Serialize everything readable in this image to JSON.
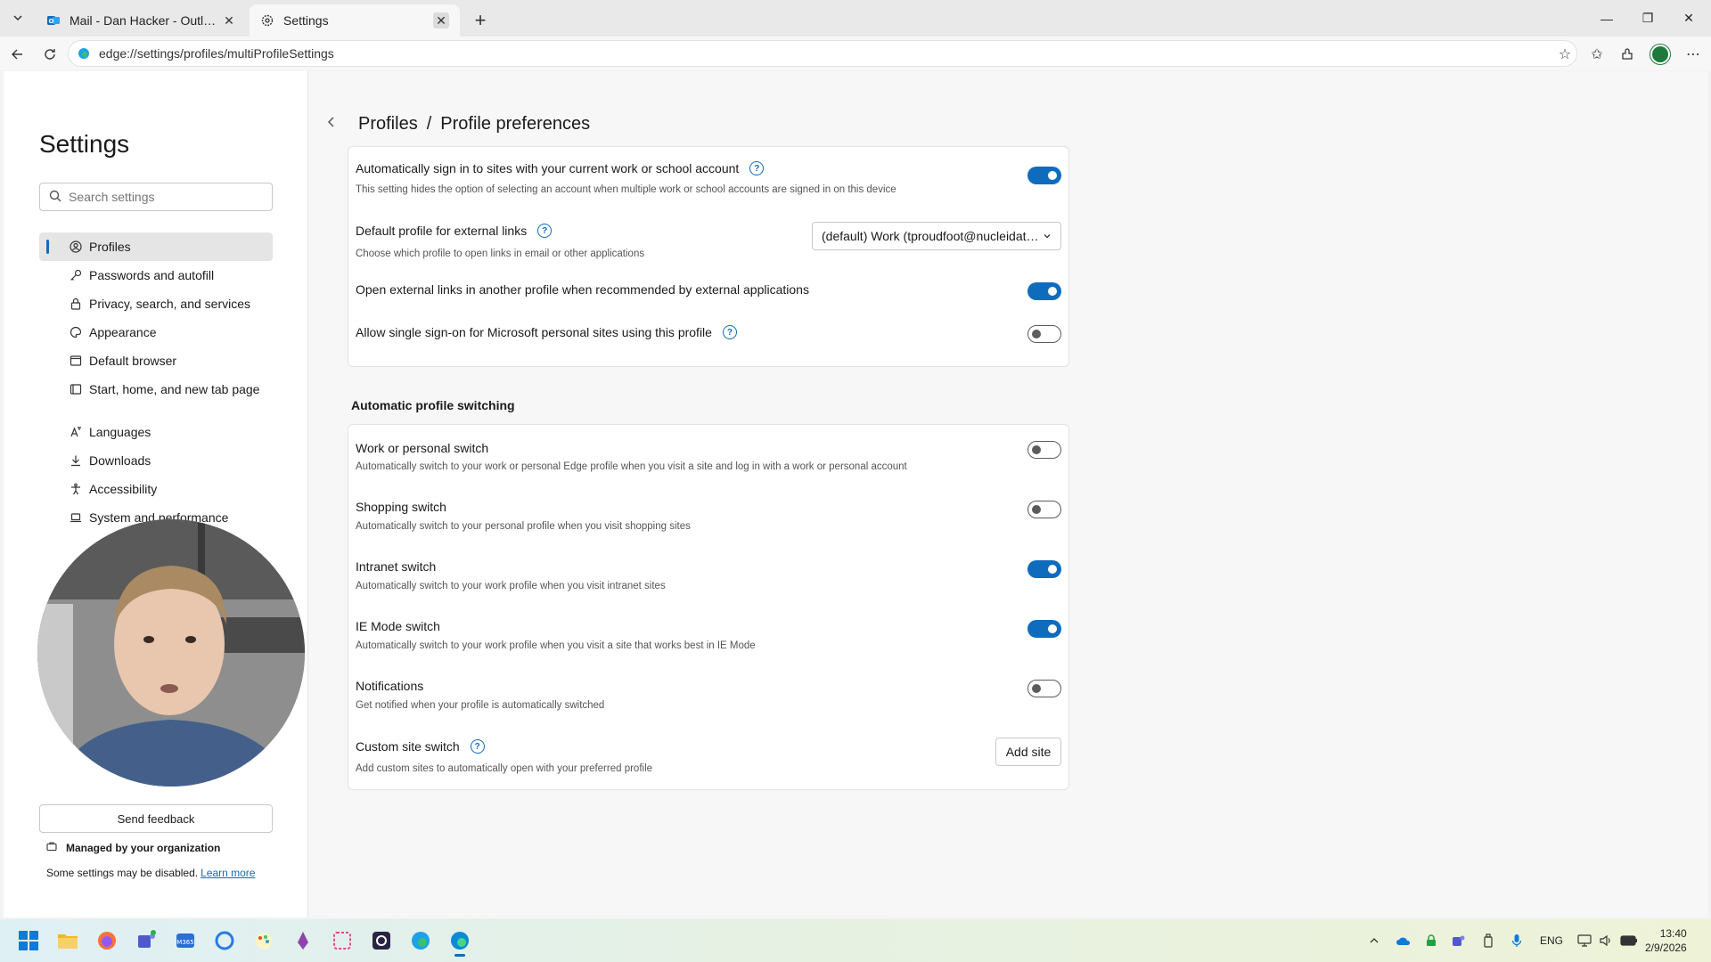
{
  "tabs": [
    {
      "title": "Mail - Dan Hacker - Outlook",
      "icon": "outlook-icon"
    },
    {
      "title": "Settings",
      "icon": "gear-icon"
    }
  ],
  "address": {
    "url": "edge://settings/profiles/multiProfileSettings"
  },
  "sidebar": {
    "title": "Settings",
    "search_placeholder": "Search settings",
    "items": [
      {
        "label": "Profiles",
        "icon": "profile-icon"
      },
      {
        "label": "Passwords and autofill",
        "icon": "key-icon"
      },
      {
        "label": "Privacy, search, and services",
        "icon": "lock-icon"
      },
      {
        "label": "Appearance",
        "icon": "palette-icon"
      },
      {
        "label": "Default browser",
        "icon": "browser-icon"
      },
      {
        "label": "Start, home, and new tab page",
        "icon": "home-icon"
      },
      {
        "label": "Languages",
        "icon": "languages-icon"
      },
      {
        "label": "Downloads",
        "icon": "download-icon"
      },
      {
        "label": "Accessibility",
        "icon": "accessibility-icon"
      },
      {
        "label": "System and performance",
        "icon": "laptop-icon"
      }
    ],
    "feedback_label": "Send feedback",
    "managed_label": "Managed by your organization",
    "managed_note": "Some settings may be disabled.",
    "learn_more": "Learn more"
  },
  "breadcrumb": {
    "parent": "Profiles",
    "separator": "/",
    "current": "Profile preferences"
  },
  "preferences": {
    "auto_signin": {
      "title": "Automatically sign in to sites with your current work or school account",
      "desc": "This setting hides the option of selecting an account when multiple work or school accounts are signed in on this device",
      "on": true
    },
    "default_profile": {
      "title": "Default profile for external links",
      "desc": "Choose which profile to open links in email or other applications",
      "value": "(default) Work (tproudfoot@nucleidatacenter.com)"
    },
    "open_external": {
      "title": "Open external links in another profile when recommended by external applications",
      "on": true
    },
    "sso_personal": {
      "title": "Allow single sign-on for Microsoft personal sites using this profile",
      "on": false
    }
  },
  "switching": {
    "section_title": "Automatic profile switching",
    "work_personal": {
      "title": "Work or personal switch",
      "desc": "Automatically switch to your work or personal Edge profile when you visit a site and log in with a work or personal account",
      "on": false
    },
    "shopping": {
      "title": "Shopping switch",
      "desc": "Automatically switch to your personal profile when you visit shopping sites",
      "on": false
    },
    "intranet": {
      "title": "Intranet switch",
      "desc": "Automatically switch to your work profile when you visit intranet sites",
      "on": true
    },
    "ie_mode": {
      "title": "IE Mode switch",
      "desc": "Automatically switch to your work profile when you visit a site that works best in IE Mode",
      "on": true
    },
    "notifications": {
      "title": "Notifications",
      "desc": "Get notified when your profile is automatically switched",
      "on": false
    },
    "custom_site": {
      "title": "Custom site switch",
      "desc": "Add custom sites to automatically open with your preferred profile",
      "button": "Add site"
    }
  },
  "taskbar": {
    "language": "ENG",
    "time": "13:40",
    "date": "2/9/2026"
  },
  "colors": {
    "accent": "#0f6cbd",
    "toggle_off": "#5c5c5c"
  }
}
